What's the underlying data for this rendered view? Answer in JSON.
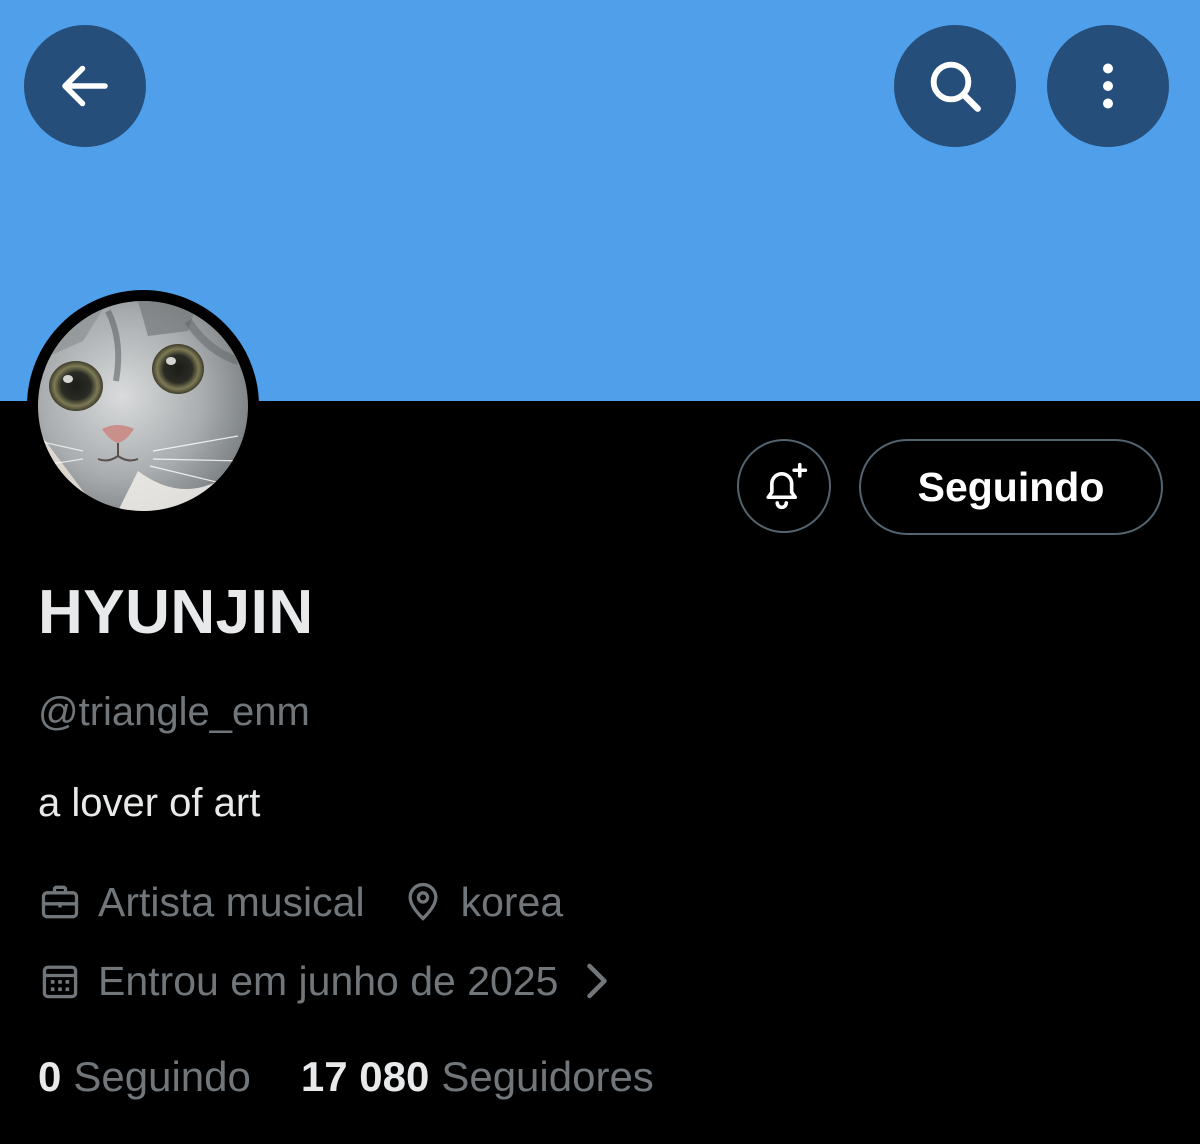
{
  "header": {
    "back_icon": "arrow-left-icon",
    "search_icon": "search-icon",
    "more_icon": "more-vertical-icon",
    "banner_color": "#4f9fea",
    "button_color": "#254e7a"
  },
  "profile": {
    "avatar_desc": "cat-photo",
    "display_name": "HYUNJIN",
    "handle": "@triangle_enm",
    "bio": "a lover of art",
    "category": "Artista musical",
    "location": "korea",
    "joined": "Entrou em junho de 2025"
  },
  "actions": {
    "notify_icon": "bell-plus-icon",
    "follow_label": "Seguindo"
  },
  "stats": {
    "following_count": "0",
    "following_label": "Seguindo",
    "followers_count": "17 080",
    "followers_label": "Seguidores"
  },
  "colors": {
    "background": "#000000",
    "text_primary": "#e7e9ea",
    "text_secondary": "#71767b",
    "border": "#536471"
  }
}
